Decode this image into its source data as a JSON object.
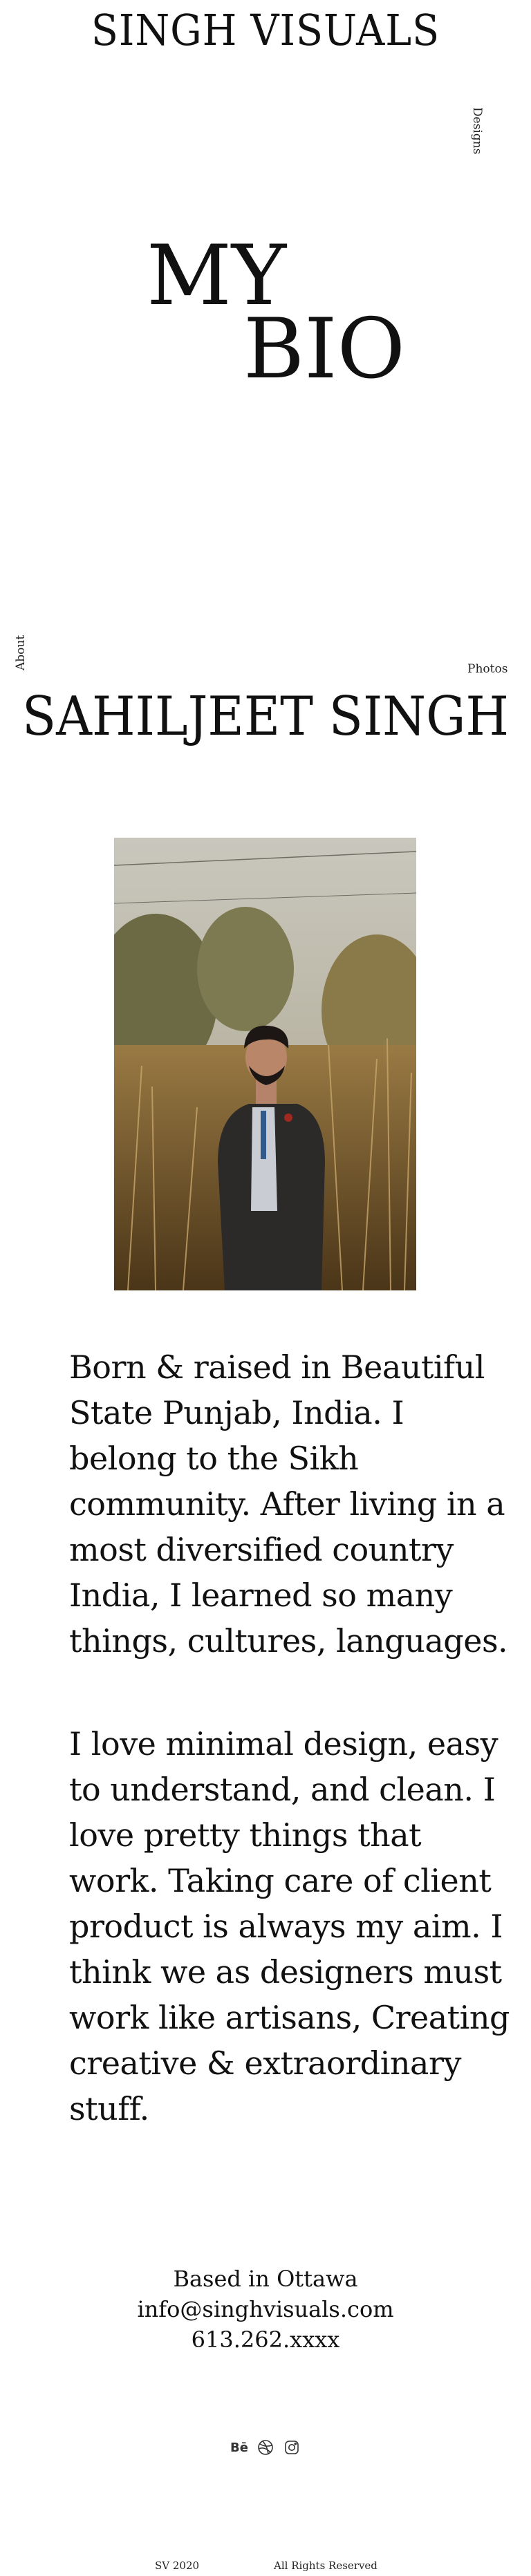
{
  "header": {
    "site_title": "SINGH VISUALS"
  },
  "nav": {
    "designs": "Designs",
    "about": "About",
    "photos": "Photos"
  },
  "hero": {
    "line1": "MY",
    "line2": "BIO"
  },
  "profile": {
    "name": "SAHILJEET SINGH",
    "photo_icon": "portrait-photo"
  },
  "bio": {
    "paragraph1": "Born & raised in Beautiful State Punjab, India. I belong to the Sikh community. After living in a most diversified country India, I learned so many things, cultures, languages.",
    "paragraph2": "I love minimal design, easy to understand, and clean. I love pretty things that work. Taking care of client product is always my aim. I think we as designers must work like artisans, Creating creative & extraordinary stuff."
  },
  "contact": {
    "city": "Based in Ottawa",
    "email": "info@singhvisuals.com",
    "phone": "613.262.xxxx"
  },
  "social": {
    "behance_label": "Bē",
    "icons": [
      "behance-icon",
      "dribbble-icon",
      "instagram-icon"
    ]
  },
  "footer": {
    "copyright": "SV 2020",
    "rights": "All Rights Reserved"
  },
  "colors": {
    "text": "#111111",
    "background": "#ffffff"
  }
}
